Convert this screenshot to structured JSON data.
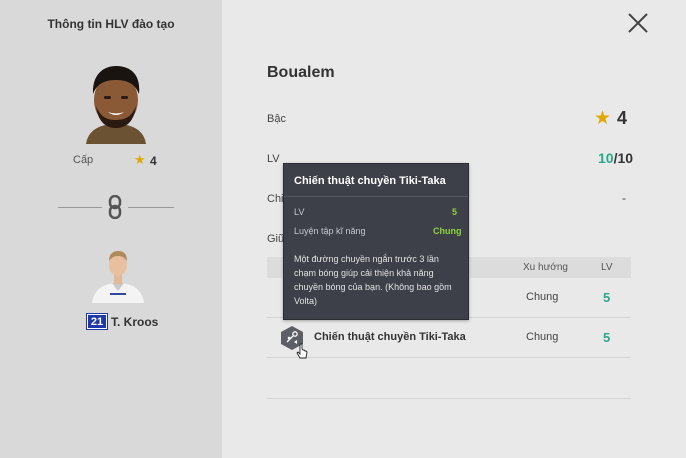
{
  "left_panel": {
    "title": "Thông tin HLV đào tạo",
    "rank_label": "Cấp",
    "rank_value": "4",
    "player": {
      "number": "21",
      "name": "T. Kroos"
    }
  },
  "right_panel": {
    "coach_name": "Boualem",
    "rank_label": "Bậc",
    "rank_value": "4",
    "lv_label": "LV",
    "lv_current": "10",
    "lv_max": "/10",
    "row3_label": "Chi",
    "row3_value": "-",
    "row4_label": "Giữ"
  },
  "skill_table": {
    "headers": {
      "trend": "Xu hướng",
      "lv": "LV"
    },
    "rows": [
      {
        "name": "",
        "type": "Chung",
        "lv": "5"
      },
      {
        "name": "Chiến thuật chuyền Tiki-Taka",
        "type": "Chung",
        "lv": "5"
      }
    ]
  },
  "tooltip": {
    "title": "Chiến thuật chuyền Tiki-Taka",
    "lv_label": "LV",
    "lv_value": "5",
    "skill_label": "Luyện tập kĩ năng",
    "skill_value": "Chung",
    "description": "Một đường chuyền ngắn trước 3 lần chạm bóng giúp cải thiện khả năng chuyền bóng của bạn. (Không bao gồm Volta)"
  },
  "colors": {
    "accent_green": "#2aa88a",
    "star_gold": "#e0a800",
    "tooltip_bg": "#3d4048",
    "tooltip_value": "#8fd33a",
    "player_number_bg": "#1f3aa8"
  },
  "icons": [
    "close-icon",
    "star-icon",
    "link-icon",
    "skill-icon",
    "cursor-icon"
  ]
}
